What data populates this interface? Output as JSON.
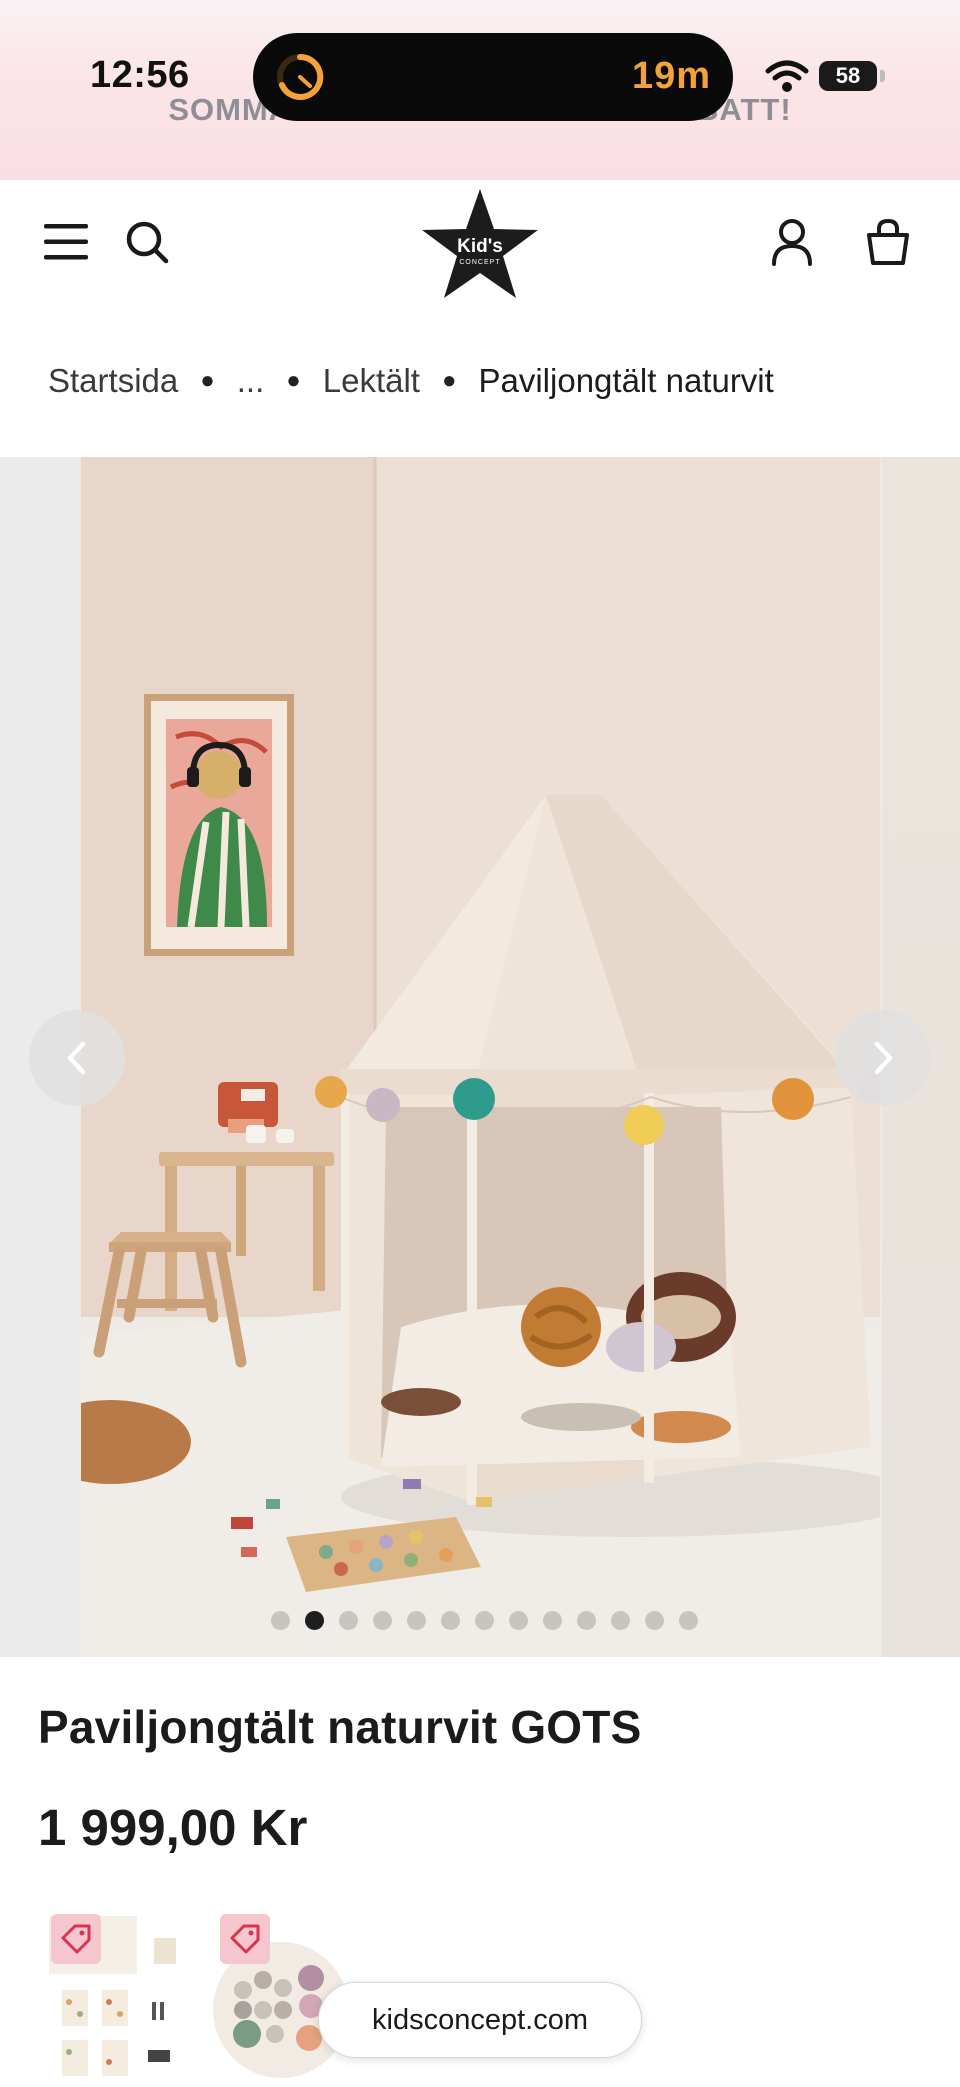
{
  "status_bar": {
    "time": "12:56",
    "timer": "19m",
    "battery": "58"
  },
  "promo_banner": {
    "text": "SOMMARREA – UPP TILL 50% RABATT!"
  },
  "header": {
    "logo_text": "Kid's",
    "logo_subtext": "CONCEPT",
    "icons": [
      "menu-icon",
      "search-icon",
      "account-icon",
      "bag-icon"
    ]
  },
  "breadcrumb": {
    "items": [
      "Startsida",
      "...",
      "Lektält",
      "Paviljongtält naturvit"
    ]
  },
  "gallery": {
    "image_count": 13,
    "active_index": 1
  },
  "product": {
    "title": "Paviljongtält naturvit GOTS",
    "price": "1 999,00 Kr"
  },
  "browser": {
    "url": "kidsconcept.com"
  },
  "colors": {
    "banner_bg": "#fbe4e7",
    "sale_tag": "#f6c6cf",
    "timer_accent": "#f3a23a"
  }
}
